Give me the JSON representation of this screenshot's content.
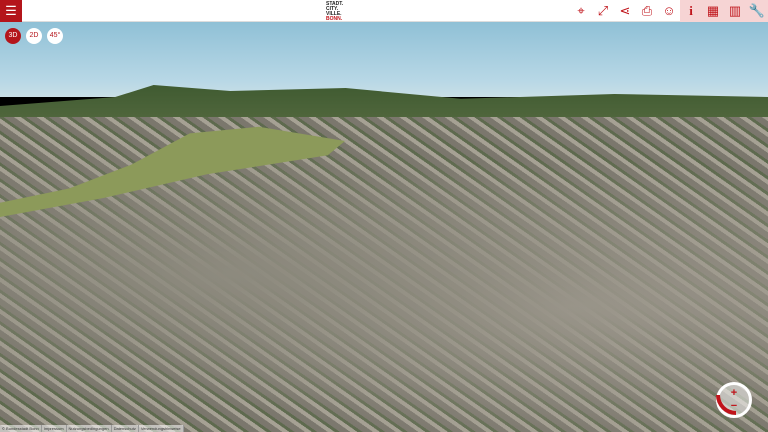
{
  "header": {
    "menu_icon": "hamburger-icon",
    "logo_lines": [
      "STADT.",
      "CITY.",
      "VILLE.",
      "BONN."
    ],
    "tools": [
      {
        "name": "location",
        "icon": "map-pin-icon",
        "glyph": "⌖"
      },
      {
        "name": "fullscreen",
        "icon": "expand-icon",
        "glyph": "⤢"
      },
      {
        "name": "share",
        "icon": "share-icon",
        "glyph": "⋖"
      },
      {
        "name": "print",
        "icon": "printer-icon",
        "glyph": "⎙"
      },
      {
        "name": "user",
        "icon": "user-icon",
        "glyph": "☺"
      },
      {
        "name": "info",
        "icon": "info-icon",
        "glyph": "i"
      },
      {
        "name": "layers",
        "icon": "grid-icon",
        "glyph": "▦"
      },
      {
        "name": "map",
        "icon": "map-icon",
        "glyph": "▥"
      },
      {
        "name": "tools",
        "icon": "wrench-icon",
        "glyph": "🔧"
      }
    ]
  },
  "views": [
    {
      "label": "3D",
      "active": true
    },
    {
      "label": "2D",
      "active": false
    },
    {
      "label": "45°",
      "active": false
    }
  ],
  "footer": [
    "© Bundesstadt Bonn",
    "Impressum",
    "Nutzungsbedingungen",
    "Datenschutz",
    "Verwendungshinweise"
  ],
  "zoom": {
    "plus": "+",
    "minus": "−"
  },
  "colors": {
    "accent": "#b4151b"
  }
}
